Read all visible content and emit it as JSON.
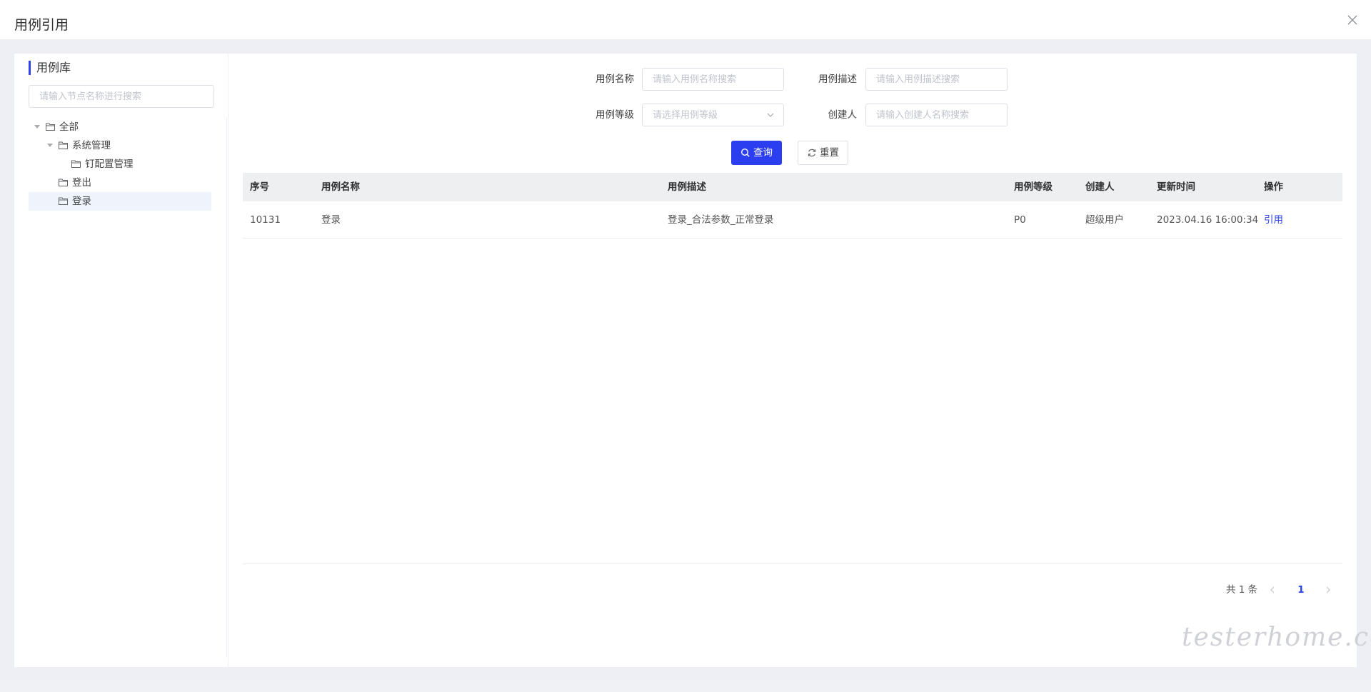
{
  "modal": {
    "title": "用例引用"
  },
  "tree_panel": {
    "title": "用例库",
    "search_placeholder": "请输入节点名称进行搜索",
    "nodes": [
      {
        "label": "全部",
        "expanded": true,
        "level": 0
      },
      {
        "label": "系统管理",
        "expanded": true,
        "level": 1
      },
      {
        "label": "钉配置管理",
        "level": 2
      },
      {
        "label": "登出",
        "level": 1
      },
      {
        "label": "登录",
        "level": 1,
        "selected": true
      }
    ]
  },
  "filters": {
    "name_label": "用例名称",
    "name_placeholder": "请输入用例名称搜索",
    "desc_label": "用例描述",
    "desc_placeholder": "请输入用例描述搜索",
    "level_label": "用例等级",
    "level_placeholder": "请选择用例等级",
    "creator_label": "创建人",
    "creator_placeholder": "请输入创建人名称搜索",
    "query_button": "查询",
    "reset_button": "重置"
  },
  "table": {
    "columns": [
      "序号",
      "用例名称",
      "用例描述",
      "用例等级",
      "创建人",
      "更新时间",
      "操作"
    ],
    "rows": [
      {
        "id": "10131",
        "name": "登录",
        "desc": "登录_合法参数_正常登录",
        "level": "P0",
        "creator": "超级用户",
        "updated": "2023.04.16 16:00:34",
        "action": "引用"
      }
    ]
  },
  "pagination": {
    "total_text": "共 1 条",
    "current_page": "1"
  },
  "watermark": "testerhome.com",
  "colors": {
    "primary": "#2b3ff0",
    "link": "#2b43e8",
    "selected_row": "#eef3fc"
  }
}
